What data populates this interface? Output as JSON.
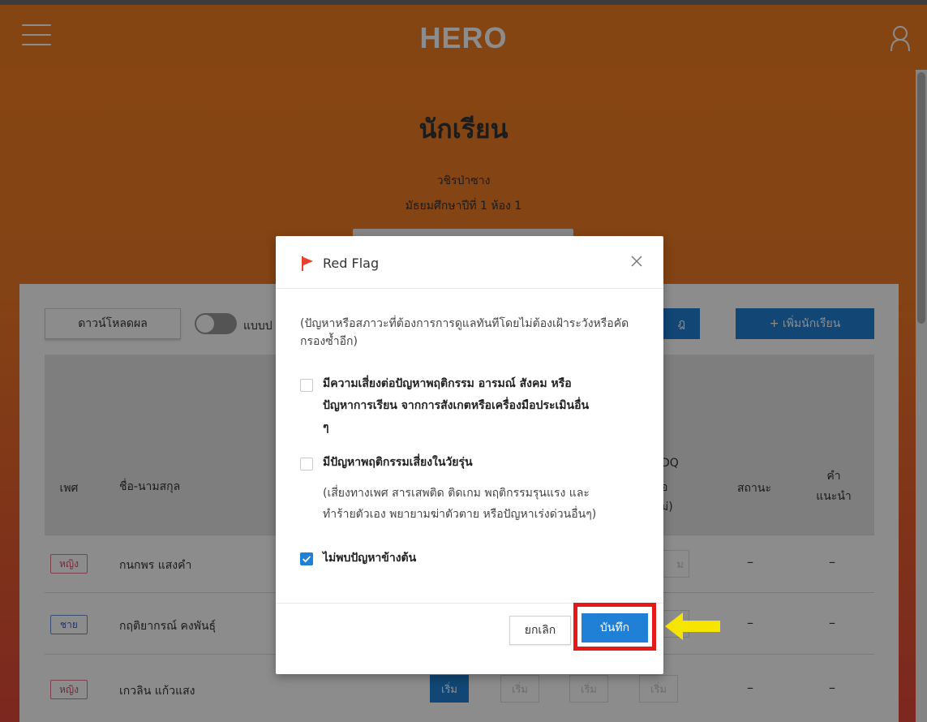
{
  "app": {
    "logo": "HERO"
  },
  "header": {
    "title": "นักเรียน",
    "school": "วชิรป่าซาง",
    "class": "มัธยมศึกษาปีที่ 1 ห้อง 1"
  },
  "toolbar": {
    "download_label": "ดาวน์โหลดผล",
    "toggle_label": "แบบป",
    "partial_button_label": "ฎ",
    "add_student_label": "+  เพิ่มนักเรียน"
  },
  "table": {
    "headers": {
      "gender": "เพศ",
      "name": "ชื่อ-นามสกุล",
      "sdq_line1": "DQ",
      "sdq_line2": "่อ",
      "sdq_line3": "ม่)",
      "status": "สถานะ",
      "advice_line1": "คำ",
      "advice_line2": "แนะนำ"
    },
    "rows": [
      {
        "gender": "หญิง",
        "name": "กนกพร แสงคำ",
        "status": "–",
        "advice": "–",
        "partial_btn": "ม"
      },
      {
        "gender": "ชาย",
        "name": "กฤติยากรณ์ คงพันธุ์",
        "status": "–",
        "advice": "–"
      },
      {
        "gender": "หญิง",
        "name": "เกวลิน แก้วแสง",
        "status": "–",
        "advice": "–",
        "buttons": [
          "เริ่ม",
          "เริ่ม",
          "เริ่ม",
          "เริ่ม"
        ]
      }
    ]
  },
  "modal": {
    "title": "Red Flag",
    "intro": "(ปัญหาหรือสภาวะที่ต้องการการดูแลทันทีโดยไม่ต้องเฝ้าระวังหรือคัดกรองซ้ำอีก)",
    "options": [
      {
        "label_line1": "มีความเสี่ยงต่อปัญหาพฤติกรรม อารมณ์ สังคม หรือ",
        "label_line2": "ปัญหาการเรียน จากการสังเกตหรือเครื่องมือประเมินอื่น",
        "label_line3": "ๆ",
        "checked": false
      },
      {
        "label_line1": "มีปัญหาพฤติกรรมเสี่ยงในวัยรุ่น",
        "note_line1": "(เสี่ยงทางเพศ สารเสพติด ติดเกม พฤติกรรมรุนแรง และ",
        "note_line2": "ทำร้ายตัวเอง พยายามฆ่าตัวตาย หรือปัญหาเร่งด่วนอื่นๆ)",
        "checked": false
      },
      {
        "label_line1": "ไม่พบปัญหาข้างต้น",
        "checked": true
      }
    ],
    "cancel_label": "ยกเลิก",
    "save_label": "บันทึก"
  },
  "colors": {
    "brand_orange": "#f37e22",
    "primary_blue": "#1f80d6",
    "highlight_red": "#e61919",
    "arrow_yellow": "#f5e400"
  },
  "icons": [
    "menu-icon",
    "user-icon",
    "flag-icon",
    "close-icon",
    "checkmark-icon",
    "arrow-left-icon"
  ]
}
